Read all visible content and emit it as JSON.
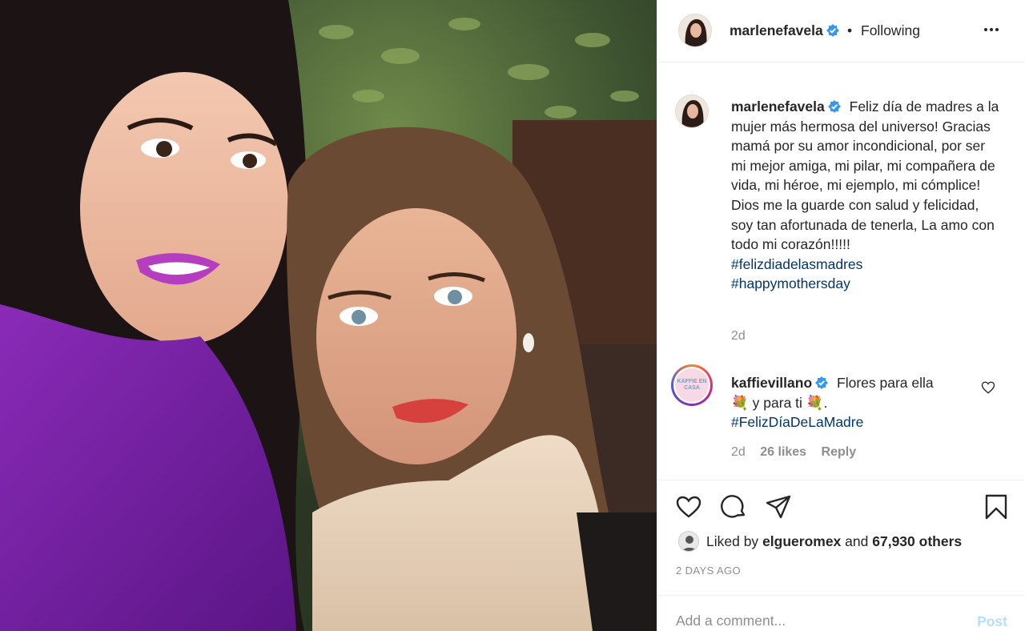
{
  "post": {
    "author": "marlenefavela",
    "follow_separator": "•",
    "follow_status": "Following",
    "more_icon": "more-horizontal-icon"
  },
  "caption": {
    "username": "marlenefavela",
    "text": "Feliz día de madres a la mujer más hermosa del universo! Gracias mamá por su amor incondicional, por ser mi mejor amiga, mi pilar, mi compañera de vida, mi héroe, mi ejemplo, mi cómplice! Dios me la guarde con salud y felicidad, soy tan afortunada de tenerla, La amo con todo mi corazón!!!!!",
    "hashtags": [
      "#felizdiadelasmadres",
      "#happymothersday"
    ],
    "time": "2d"
  },
  "comments": [
    {
      "username": "kaffievillano",
      "text_before": "Flores para ella",
      "text_mid": "y para ti",
      "text_end": ".",
      "emoji": "💐",
      "hashtag": "#FelizDíaDeLaMadre",
      "time": "2d",
      "likes": "26 likes",
      "reply": "Reply",
      "avatar_text": "KAFFIE EN CASA"
    }
  ],
  "actions": {
    "like_icon": "heart-icon",
    "comment_icon": "comment-icon",
    "share_icon": "share-icon",
    "save_icon": "bookmark-icon"
  },
  "likes": {
    "prefix": "Liked by",
    "user": "elgueromex",
    "and": "and",
    "others": "67,930 others"
  },
  "timestamp": "2 DAYS AGO",
  "add_comment": {
    "placeholder": "Add a comment...",
    "post_label": "Post"
  },
  "colors": {
    "link": "#00376b",
    "muted": "#8e8e8e",
    "verified": "#3897f0",
    "post_disabled": "#b2dffc"
  }
}
